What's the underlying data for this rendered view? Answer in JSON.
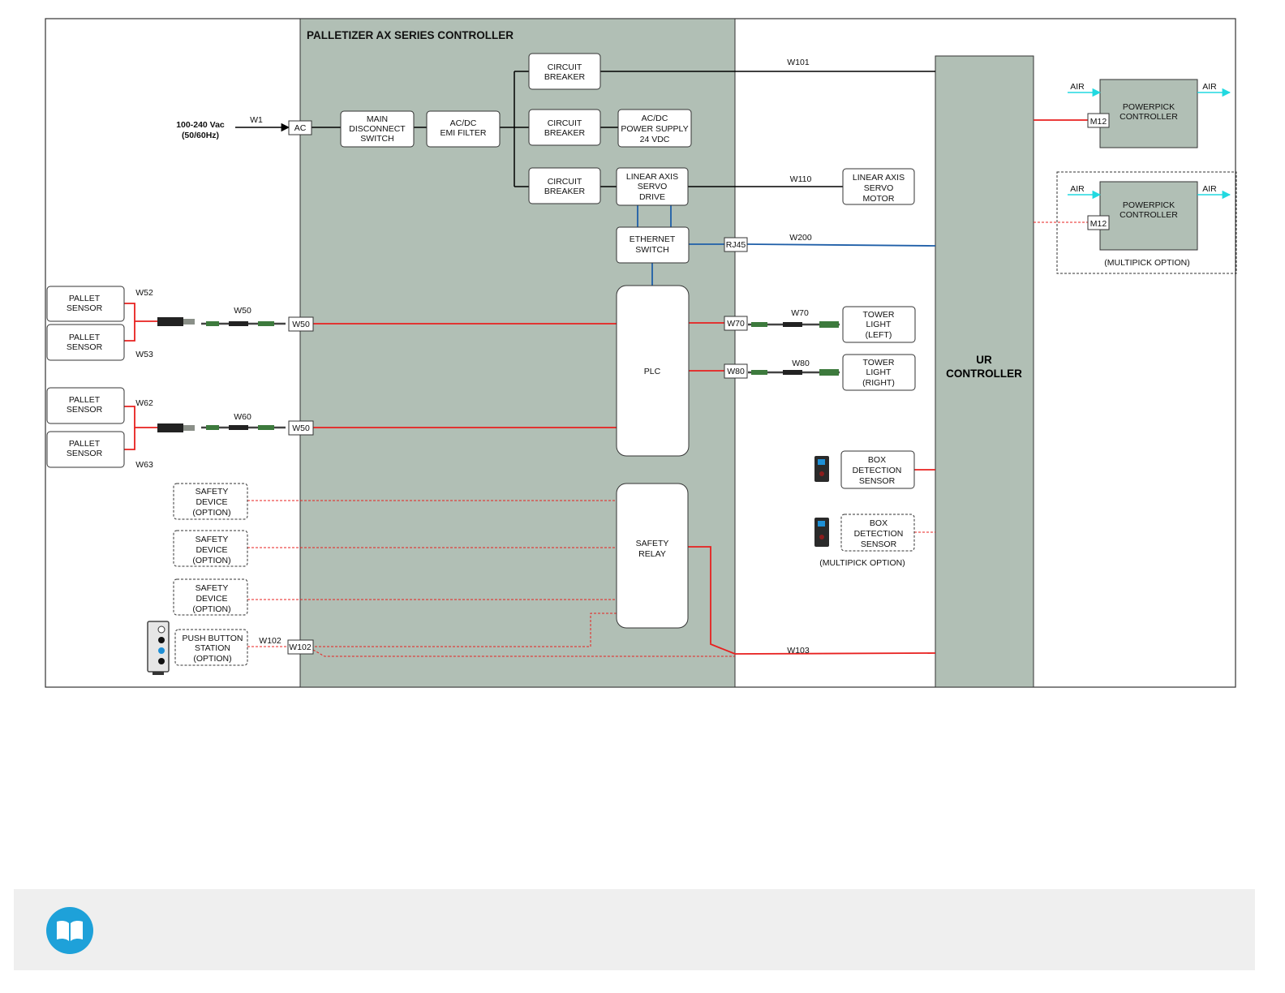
{
  "colors": {
    "controller_fill": "#b1bfb5",
    "red_wire": "#e8201f",
    "blue_wire": "#1f5fa8",
    "air": "#21d9e0",
    "logo": "#1ea1d9"
  },
  "controller_title": "PALLETIZER AX SERIES CONTROLLER",
  "power_input": {
    "label": [
      "100-240 Vac",
      "(50/60Hz)"
    ],
    "wire": "W1",
    "connector": "AC"
  },
  "main_disconnect": [
    "MAIN",
    "DISCONNECT",
    "SWITCH"
  ],
  "emi_filter": [
    "AC/DC",
    "EMI FILTER"
  ],
  "breaker_top": [
    "CIRCUIT",
    "BREAKER"
  ],
  "breaker_mid": [
    "CIRCUIT",
    "BREAKER"
  ],
  "breaker_bottom": [
    "CIRCUIT",
    "BREAKER"
  ],
  "power_supply": [
    "AC/DC",
    "POWER SUPPLY",
    "24 VDC"
  ],
  "servo_drive": [
    "LINEAR AXIS",
    "SERVO",
    "DRIVE"
  ],
  "ethernet_switch": [
    "ETHERNET",
    "SWITCH"
  ],
  "plc": "PLC",
  "safety_relay": [
    "SAFETY",
    "RELAY"
  ],
  "ur_controller": [
    "UR",
    "CONTROLLER"
  ],
  "servo_motor": [
    "LINEAR AXIS",
    "SERVO",
    "MOTOR"
  ],
  "tower_light_left": [
    "TOWER",
    "LIGHT",
    "(LEFT)"
  ],
  "tower_light_right": [
    "TOWER",
    "LIGHT",
    "(RIGHT)"
  ],
  "box_sensor": [
    "BOX",
    "DETECTION",
    "SENSOR"
  ],
  "box_sensor_option": [
    "BOX",
    "DETECTION",
    "SENSOR"
  ],
  "multipick_option_label": "(MULTIPICK OPTION)",
  "powerpick_1": [
    "POWERPICK",
    "CONTROLLER"
  ],
  "powerpick_2": [
    "POWERPICK",
    "CONTROLLER"
  ],
  "powerpick_multipick_label": "(MULTIPICK OPTION)",
  "air_label": "AIR",
  "m12_label": "M12",
  "rj45_label": "RJ45",
  "pallet_sensor": [
    "PALLET",
    "SENSOR"
  ],
  "safety_device": [
    "SAFETY",
    "DEVICE",
    "(OPTION)"
  ],
  "push_button_station": [
    "PUSH BUTTON",
    "STATION",
    "(OPTION)"
  ],
  "wires": {
    "w101": "W101",
    "w110": "W110",
    "w200": "W200",
    "w70": "W70",
    "w80": "W80",
    "w103": "W103",
    "w52": "W52",
    "w53": "W53",
    "w50": "W50",
    "w62": "W62",
    "w63": "W63",
    "w60": "W60",
    "w102": "W102"
  },
  "connectors": {
    "w50_a": "W50",
    "w50_b": "W50",
    "w70": "W70",
    "w80": "W80",
    "w102": "W102"
  }
}
